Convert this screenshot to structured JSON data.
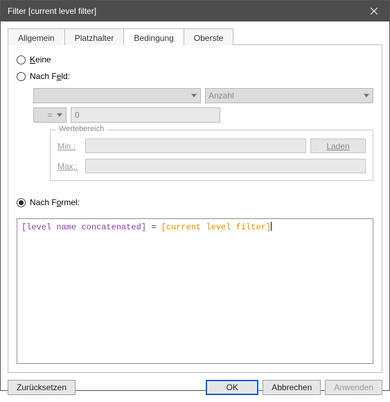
{
  "window": {
    "title": "Filter [current level filter]"
  },
  "tabs": [
    {
      "label": "Allgemein",
      "active": false
    },
    {
      "label": "Platzhalter",
      "active": false
    },
    {
      "label": "Bedingung",
      "active": true
    },
    {
      "label": "Oberste",
      "active": false
    }
  ],
  "radios": {
    "none": {
      "label_underline": "K",
      "label_rest": "eine",
      "selected": false
    },
    "byField": {
      "label_pre": "Nach F",
      "label_underline": "e",
      "label_post": "ld:",
      "selected": false
    },
    "byFormula": {
      "label_pre": "Nach F",
      "label_underline": "o",
      "label_post": "rmel:",
      "selected": true
    }
  },
  "by_field": {
    "combo_field": "",
    "combo_agg": "Anzahl",
    "combo_op": "=",
    "value": "0"
  },
  "range": {
    "legend": "Wertebereich",
    "min_label": "Min.:",
    "max_label": "Max.:",
    "load_btn": "Laden"
  },
  "formula": {
    "token_field": "[level name concatenated]",
    "token_op": " = ",
    "token_param": "[current level filter]"
  },
  "footer": {
    "reset": "Zurücksetzen",
    "ok": "OK",
    "cancel": "Abbrechen",
    "apply": "Anwenden"
  }
}
